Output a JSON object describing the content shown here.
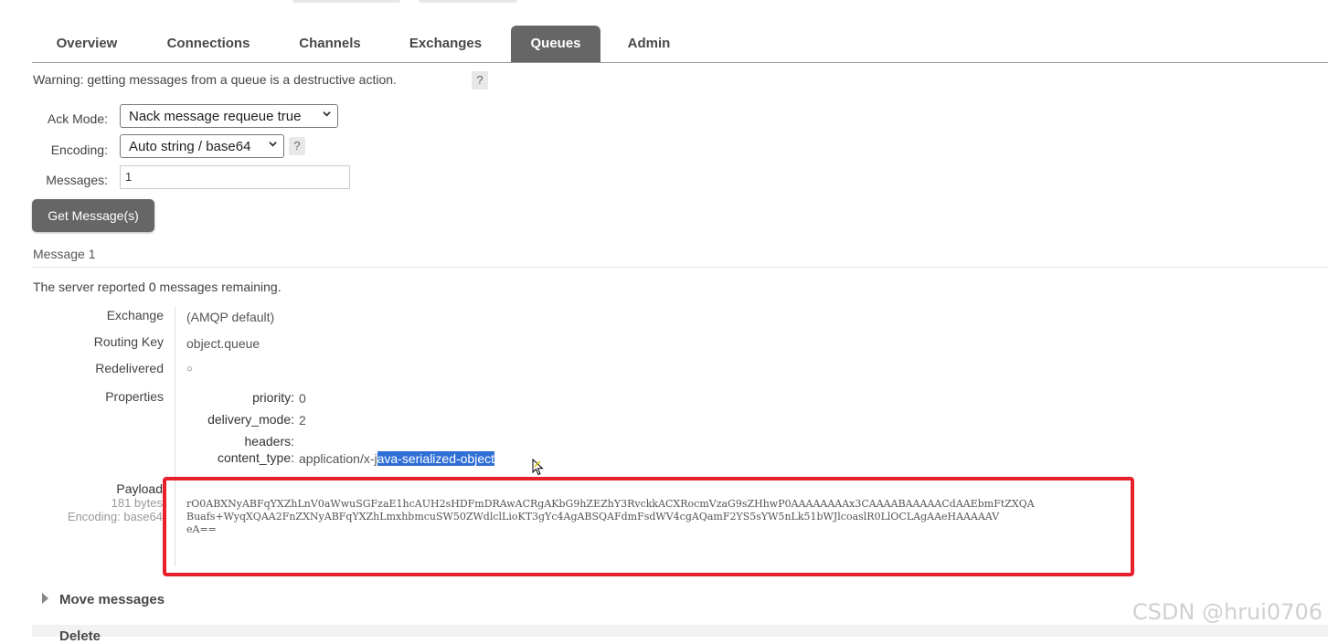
{
  "tabs": [
    "Overview",
    "Connections",
    "Channels",
    "Exchanges",
    "Queues",
    "Admin"
  ],
  "active_tab": "Queues",
  "warning": "Warning: getting messages from a queue is a destructive action.",
  "help_glyph": "?",
  "form": {
    "ack_label": "Ack Mode:",
    "ack_value": "Nack message requeue true",
    "encoding_label": "Encoding:",
    "encoding_value": "Auto string / base64",
    "messages_label": "Messages:",
    "messages_value": "1",
    "get_button": "Get Message(s)"
  },
  "message": {
    "heading": "Message 1",
    "server_prefix": "The server reported",
    "server_count": "0",
    "server_suffix": "messages remaining.",
    "exchange_label": "Exchange",
    "exchange_value": "(AMQP default)",
    "routing_key_label": "Routing Key",
    "routing_key_value": "object.queue",
    "redelivered_label": "Redelivered",
    "redelivered_value": "○",
    "properties_label": "Properties",
    "properties": {
      "priority_key": "priority:",
      "priority_value": "0",
      "delivery_mode_key": "delivery_mode:",
      "delivery_mode_value": "2",
      "headers_key": "headers:",
      "content_type_key": "content_type:",
      "content_type_plain": "application/x-j",
      "content_type_selected": "ava-serialized-object"
    },
    "payload_label": "Payload",
    "payload_size": "181 bytes",
    "payload_encoding": "Encoding: base64",
    "payload_lines": [
      "rO0ABXNyABFqYXZhLnV0aWwuSGFzaE1hcAUH2sHDFmDRAwACRgAKbG9hZEZhY3RvckkACXRocmVzaG9sZHhwP0AAAAAAAAx3CAAAABAAAAACdAAEbmFtZXQA",
      "Buafs+WyqXQAA2FnZXNyABFqYXZhLmxhbmcuSW50ZWdlclLioKT3gYc4AgABSQAFdmFsdWV4cgAQamF2YS5sYW5nLk51bWJlcoaslR0LlOCLAgAAeHAAAAAV",
      "eA=="
    ]
  },
  "sections": {
    "move": "Move messages",
    "delete": "Delete"
  },
  "watermark": "CSDN @hrui0706",
  "colors": {
    "tab_active_bg": "#666666",
    "button_bg": "#666666",
    "highlight_box": "#e8202a",
    "selection": "#2f6fd6"
  }
}
